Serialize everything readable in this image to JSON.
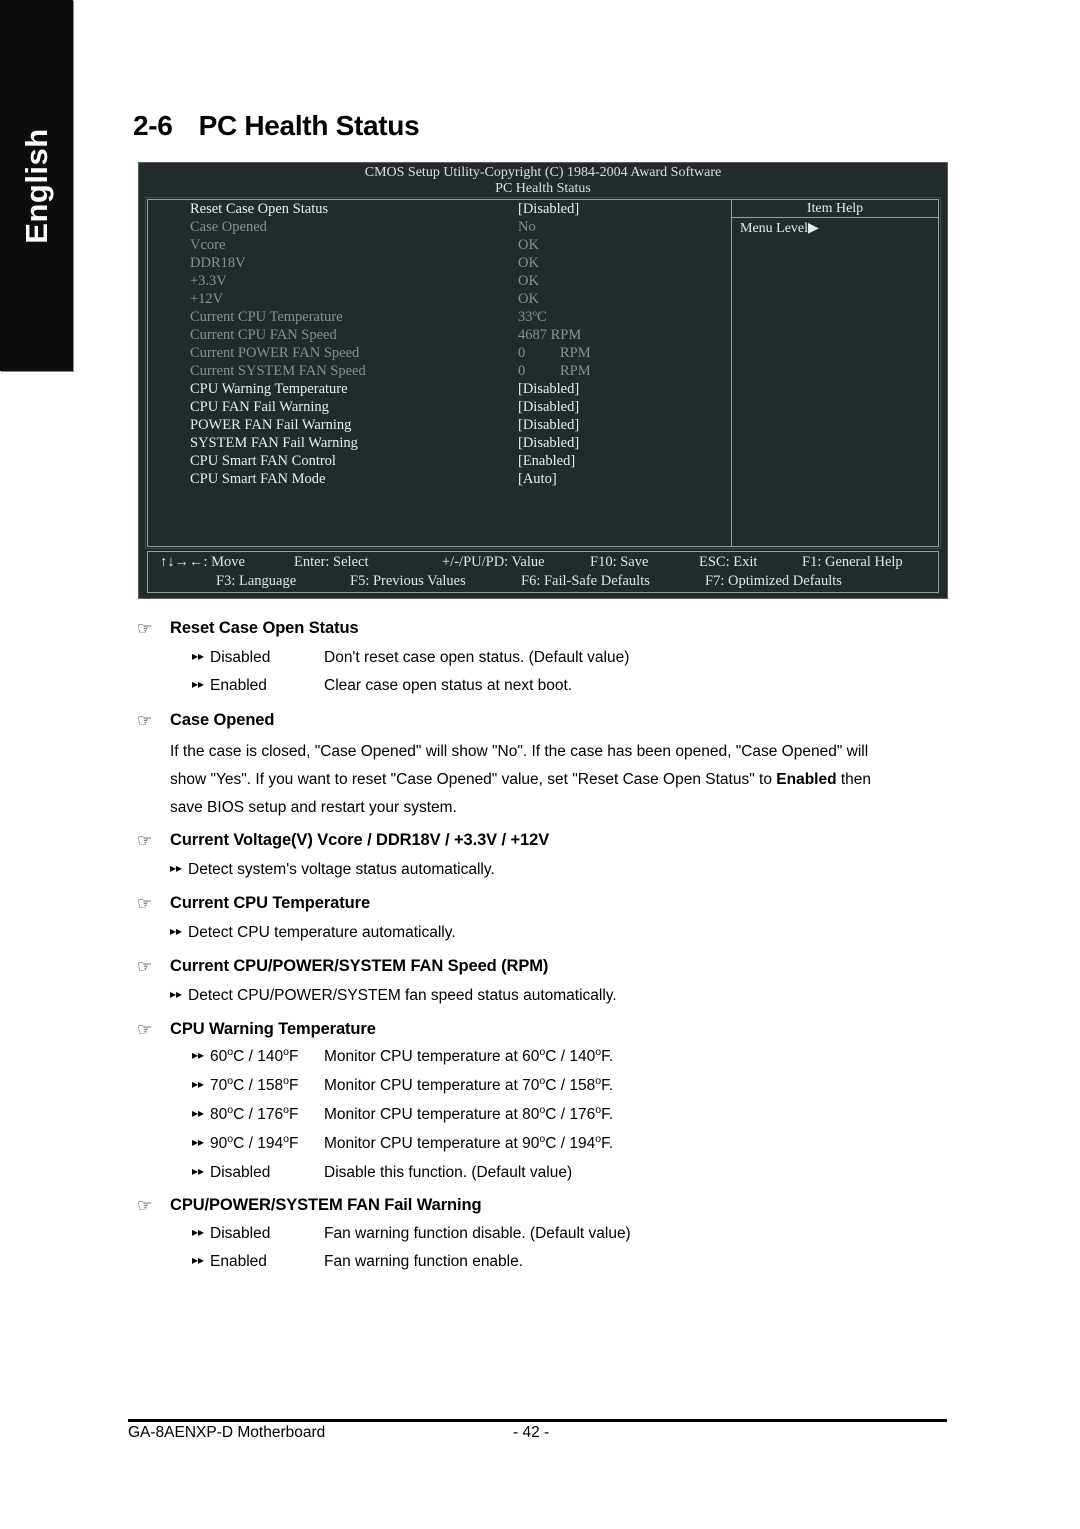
{
  "sidebar": {
    "language_tab": "English"
  },
  "page": {
    "section_number": "2-6",
    "title": "PC Health Status"
  },
  "bios": {
    "header_line1": "CMOS Setup Utility-Copyright (C) 1984-2004 Award Software",
    "header_line2": "PC Health Status",
    "item_help_title": "Item Help",
    "menu_level": "Menu Level",
    "menu_level_arrow": "▶",
    "rows": [
      {
        "label": "Reset Case Open Status",
        "value": "[Disabled]",
        "value2": "",
        "style": "bright"
      },
      {
        "label": "Case Opened",
        "value": "No",
        "value2": "",
        "style": "dim"
      },
      {
        "label": "Vcore",
        "value": "OK",
        "value2": "",
        "style": "dim"
      },
      {
        "label": "DDR18V",
        "value": "OK",
        "value2": "",
        "style": "dim"
      },
      {
        "label": "+3.3V",
        "value": "OK",
        "value2": "",
        "style": "dim"
      },
      {
        "label": "+12V",
        "value": "OK",
        "value2": "",
        "style": "dim"
      },
      {
        "label": "Current CPU Temperature",
        "value": "33ºC",
        "value2": "",
        "style": "dim"
      },
      {
        "label": "Current CPU FAN Speed",
        "value": "4687 RPM",
        "value2": "",
        "style": "dim"
      },
      {
        "label": "Current POWER FAN Speed",
        "value": "0",
        "value2": "RPM",
        "style": "dim"
      },
      {
        "label": "Current SYSTEM FAN Speed",
        "value": "0",
        "value2": "RPM",
        "style": "dim"
      },
      {
        "label": "CPU Warning Temperature",
        "value": "[Disabled]",
        "value2": "",
        "style": "bright"
      },
      {
        "label": "CPU FAN Fail Warning",
        "value": "[Disabled]",
        "value2": "",
        "style": "bright"
      },
      {
        "label": "POWER FAN Fail Warning",
        "value": "[Disabled]",
        "value2": "",
        "style": "bright"
      },
      {
        "label": "SYSTEM FAN Fail Warning",
        "value": "[Disabled]",
        "value2": "",
        "style": "bright"
      },
      {
        "label": "CPU Smart FAN Control",
        "value": "[Enabled]",
        "value2": "",
        "style": "bright"
      },
      {
        "label": "CPU Smart FAN Mode",
        "value": "[Auto]",
        "value2": "",
        "style": "bright"
      }
    ],
    "footer": {
      "move": "↑↓→←: Move",
      "enter": "Enter: Select",
      "value": "+/-/PU/PD: Value",
      "f10": "F10: Save",
      "esc": "ESC: Exit",
      "f1": "F1: General Help",
      "f3": "F3: Language",
      "f5": "F5: Previous Values",
      "f6": "F6: Fail-Safe Defaults",
      "f7": "F7: Optimized Defaults"
    }
  },
  "sections": {
    "reset_case_open": {
      "heading": "Reset Case Open Status",
      "options": [
        {
          "label": "Disabled",
          "desc": "Don't reset case open status. (Default value)"
        },
        {
          "label": "Enabled",
          "desc": "Clear case open status at next boot."
        }
      ]
    },
    "case_opened": {
      "heading": "Case Opened",
      "para_a": "If the case is closed, \"Case Opened\" will show \"No\". If the case has been opened, \"Case Opened\" will",
      "para_b_pre": "show \"Yes\". If you want to reset \"Case Opened\" value, set \"Reset Case Open Status\" to ",
      "para_b_bold": "Enabled",
      "para_b_post": " then",
      "para_c": "save BIOS setup and restart your system."
    },
    "current_voltage": {
      "heading": "Current Voltage(V) Vcore / DDR18V / +3.3V / +12V",
      "desc": "Detect system's voltage status automatically."
    },
    "current_cpu_temp": {
      "heading": "Current CPU Temperature",
      "desc": "Detect CPU temperature automatically."
    },
    "current_fan_speed": {
      "heading": "Current CPU/POWER/SYSTEM FAN Speed (RPM)",
      "desc": "Detect CPU/POWER/SYSTEM fan speed status automatically."
    },
    "cpu_warning_temp": {
      "heading": "CPU Warning Temperature",
      "options": [
        {
          "c": "60",
          "f": "140"
        },
        {
          "c": "70",
          "f": "158"
        },
        {
          "c": "80",
          "f": "176"
        },
        {
          "c": "90",
          "f": "194"
        }
      ],
      "monitor_prefix": "Monitor CPU temperature at ",
      "disabled_label": "Disabled",
      "disabled_desc": "Disable this function. (Default value)"
    },
    "fan_fail_warning": {
      "heading": "CPU/POWER/SYSTEM FAN Fail Warning",
      "options": [
        {
          "label": "Disabled",
          "desc": "Fan warning function disable. (Default value)"
        },
        {
          "label": "Enabled",
          "desc": "Fan warning function enable."
        }
      ]
    }
  },
  "footer": {
    "product": "GA-8AENXP-D Motherboard",
    "page_number": "- 42 -"
  },
  "glyphs": {
    "hand": "☞",
    "double_arrow": "▸▸"
  }
}
